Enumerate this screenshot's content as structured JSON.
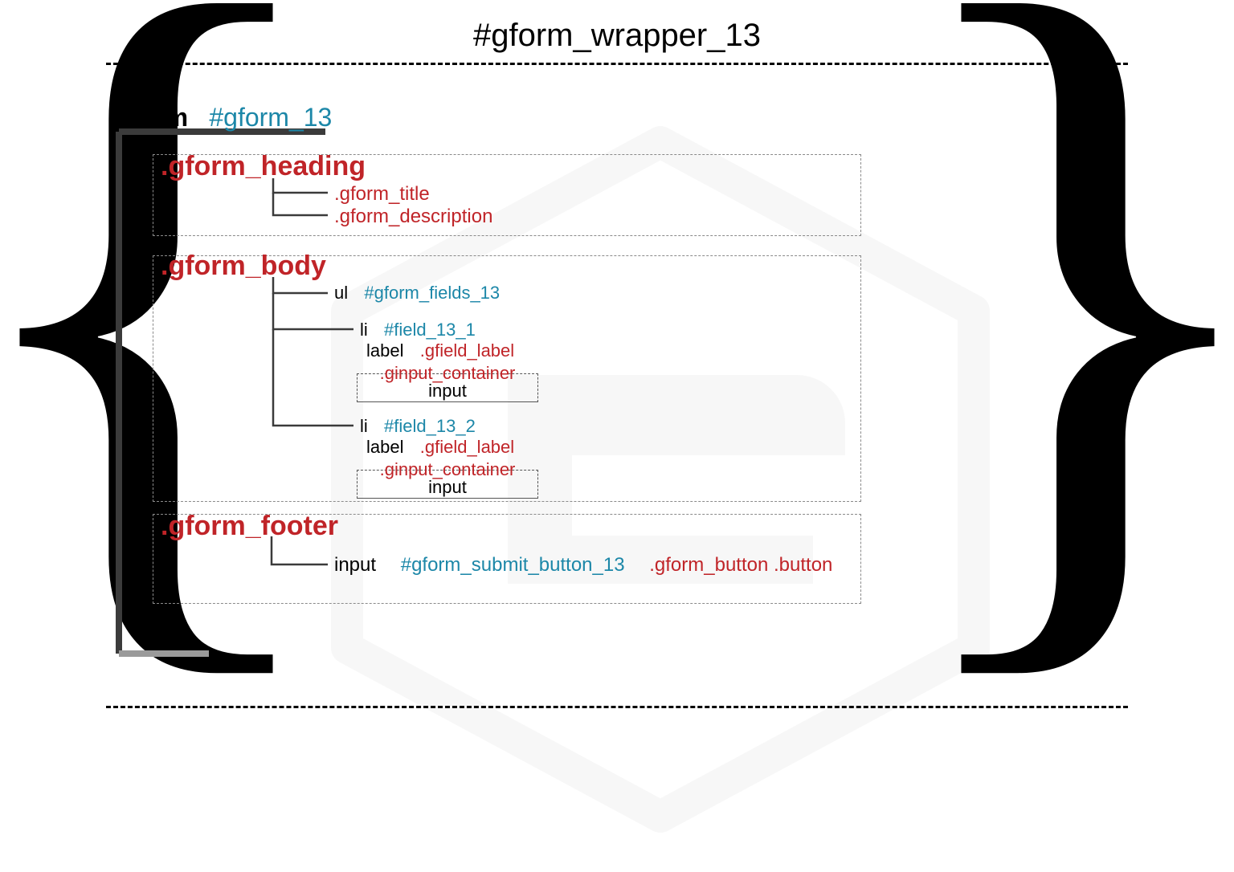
{
  "title": "#gform_wrapper_13",
  "form": {
    "tag": "form",
    "id": "#gform_13"
  },
  "sections": {
    "heading": {
      "class": ".gform_heading",
      "children": {
        "title": ".gform_title",
        "description": ".gform_description"
      }
    },
    "body": {
      "class": ".gform_body",
      "ul": {
        "tag": "ul",
        "id": "#gform_fields_13"
      },
      "fields": [
        {
          "li_tag": "li",
          "li_id": "#field_13_1",
          "label_tag": "label",
          "label_class": ".gfield_label",
          "container_class": ".ginput_container",
          "input_tag": "input"
        },
        {
          "li_tag": "li",
          "li_id": "#field_13_2",
          "label_tag": "label",
          "label_class": ".gfield_label",
          "container_class": ".ginput_container",
          "input_tag": "input"
        }
      ]
    },
    "footer": {
      "class": ".gform_footer",
      "input_tag": "input",
      "submit_id": "#gform_submit_button_13",
      "submit_classes": ".gform_button .button"
    }
  },
  "colors": {
    "id": "#1c87a8",
    "class": "#c02428",
    "text": "#000000"
  }
}
